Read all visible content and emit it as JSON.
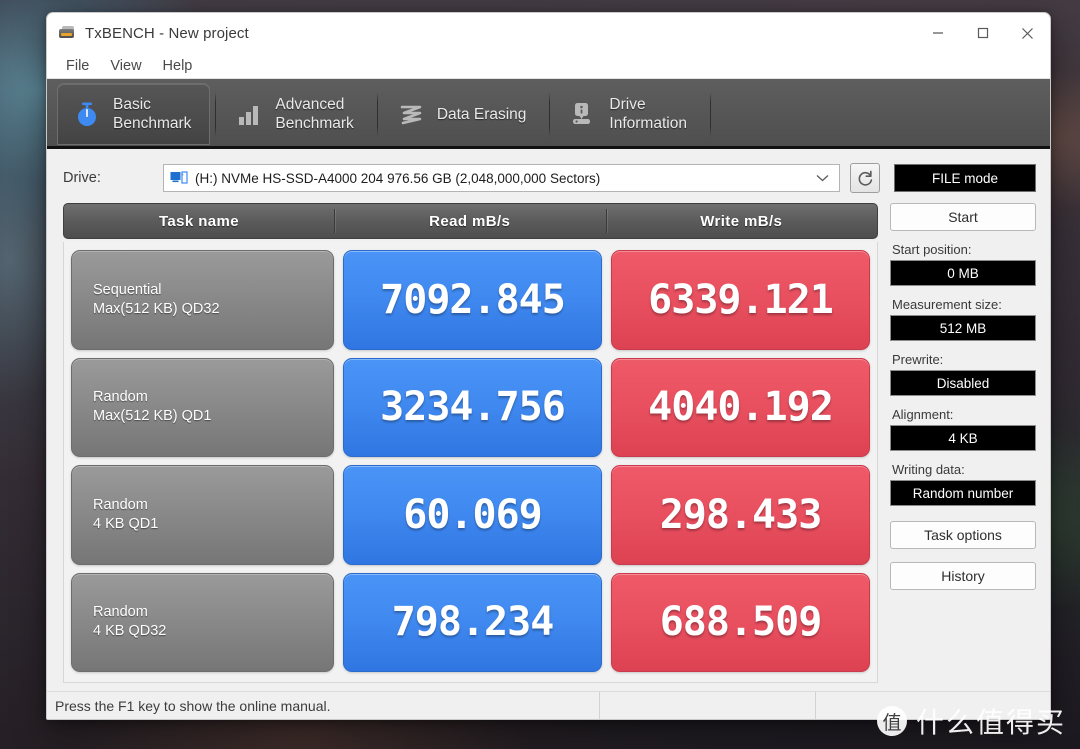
{
  "window": {
    "title": "TxBENCH - New project",
    "app_icon": "hard-drive-icon",
    "controls": {
      "minimize": "minimize-icon",
      "maximize": "maximize-icon",
      "close": "close-icon"
    }
  },
  "menubar": {
    "items": [
      "File",
      "View",
      "Help"
    ]
  },
  "tabs": [
    {
      "label": "Basic\nBenchmark",
      "icon": "stopwatch-icon",
      "active": true
    },
    {
      "label": "Advanced\nBenchmark",
      "icon": "bar-chart-icon",
      "active": false
    },
    {
      "label": "Data Erasing",
      "icon": "eraser-icon",
      "active": false
    },
    {
      "label": "Drive\nInformation",
      "icon": "drive-info-icon",
      "active": false
    }
  ],
  "drive_row": {
    "label": "Drive:",
    "selected": "(H:) NVMe HS-SSD-A4000 204  976.56 GB (2,048,000,000 Sectors)",
    "combo_icon": "monitor-drive-icon",
    "refresh_icon": "refresh-icon",
    "file_mode_label": "FILE mode"
  },
  "table": {
    "headers": [
      "Task name",
      "Read mB/s",
      "Write mB/s"
    ],
    "rows": [
      {
        "name_line1": "Sequential",
        "name_line2": "Max(512 KB) QD32",
        "read": "7092.845",
        "write": "6339.121"
      },
      {
        "name_line1": "Random",
        "name_line2": "Max(512 KB) QD1",
        "read": "3234.756",
        "write": "4040.192"
      },
      {
        "name_line1": "Random",
        "name_line2": "4 KB QD1",
        "read": "60.069",
        "write": "298.433"
      },
      {
        "name_line1": "Random",
        "name_line2": "4 KB QD32",
        "read": "798.234",
        "write": "688.509"
      }
    ]
  },
  "side_panel": {
    "start_label": "Start",
    "start_position_label": "Start position:",
    "start_position_value": "0 MB",
    "measurement_size_label": "Measurement size:",
    "measurement_size_value": "512 MB",
    "prewrite_label": "Prewrite:",
    "prewrite_value": "Disabled",
    "alignment_label": "Alignment:",
    "alignment_value": "4 KB",
    "writing_data_label": "Writing data:",
    "writing_data_value": "Random number",
    "task_options_label": "Task options",
    "history_label": "History"
  },
  "statusbar": {
    "message": "Press the F1 key to show the online manual.",
    "segment2": "",
    "segment3": ""
  },
  "watermark": {
    "logo_char": "值",
    "text": "什么值得买"
  },
  "colors": {
    "read_accent": "#3f88ef",
    "write_accent": "#e84f5f",
    "task_cell": "#8a8a8a",
    "tab_bar": "#575757",
    "field_bg": "#000000"
  }
}
